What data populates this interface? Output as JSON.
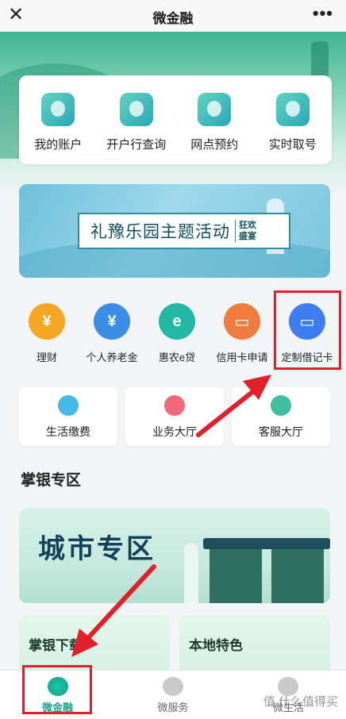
{
  "header": {
    "title": "微金融",
    "close_icon": "close-icon",
    "more_icon": "more-icon"
  },
  "quick_actions": [
    {
      "label": "我的账户",
      "icon": "account-icon"
    },
    {
      "label": "开户行查询",
      "icon": "bank-search-icon"
    },
    {
      "label": "网点预约",
      "icon": "calendar-icon"
    },
    {
      "label": "实时取号",
      "icon": "ticket-icon"
    }
  ],
  "banner": {
    "main_text": "礼豫乐园主题活动",
    "side_text": "狂欢盛宴"
  },
  "features": [
    {
      "label": "理财",
      "icon": "money-bag-icon",
      "color": "#f5a623"
    },
    {
      "label": "个人养老金",
      "icon": "pension-icon",
      "color": "#3a8ee6"
    },
    {
      "label": "惠农e贷",
      "icon": "loan-icon",
      "color": "#22b8a3"
    },
    {
      "label": "信用卡申请",
      "icon": "credit-card-icon",
      "color": "#f07b3f"
    },
    {
      "label": "定制借记卡",
      "icon": "debit-card-icon",
      "color": "#3c7df0"
    }
  ],
  "services": [
    {
      "label": "生活缴费",
      "icon": "water-drop-icon",
      "color": "#47b9e8"
    },
    {
      "label": "业务大厅",
      "icon": "house-icon",
      "color": "#f06a7a"
    },
    {
      "label": "客服大厅",
      "icon": "service-agent-icon",
      "color": "#3fbf9f"
    }
  ],
  "section": {
    "title": "掌银专区"
  },
  "city_banner": {
    "text": "城市专区"
  },
  "cards": [
    {
      "title": "掌银下载"
    },
    {
      "title": "本地特色"
    }
  ],
  "tabs": [
    {
      "label": "微金融",
      "icon": "finance-tab-icon",
      "active": true
    },
    {
      "label": "微服务",
      "icon": "service-tab-icon",
      "active": false
    },
    {
      "label": "微生活",
      "icon": "life-tab-icon",
      "active": false
    }
  ],
  "watermark": "值 什么值得买",
  "colors": {
    "highlight": "#e0202a",
    "brand": "#16a58d"
  }
}
